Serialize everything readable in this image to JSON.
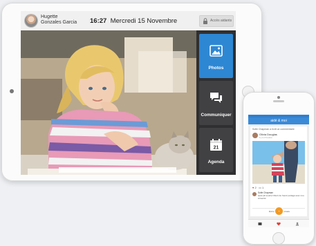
{
  "tablet": {
    "user": {
      "first_name": "Hugette",
      "last_name": "Gonzales Garcia"
    },
    "clock": {
      "time": "16:27",
      "date": "Mercredi 15 Novembre"
    },
    "access_button": {
      "label": "Accès aidants",
      "icon": "lock-icon"
    },
    "sidebar": [
      {
        "label": "Photos",
        "icon": "photo-icon",
        "active": true
      },
      {
        "label": "Communiquer",
        "icon": "chat-bubbles-icon",
        "active": false
      },
      {
        "label": "Agenda",
        "icon": "calendar-icon",
        "day": "21",
        "active": false
      }
    ]
  },
  "phone": {
    "title": "aidé & moi",
    "post": {
      "notice": "Sofie Chapman a écrit un commentaire",
      "author": "Olivia Douglas",
      "time": "il y a 2 heures",
      "likes": "2",
      "comments": "1",
      "comment": {
        "author": "Sofie Chapman",
        "text": "Quel joli sourire! Merci de l'avoir partagé avec moi, à bientôt"
      },
      "reply_label": "Écrire un commentaire"
    },
    "fab_label": "+",
    "tabs": [
      {
        "icon": "home-icon"
      },
      {
        "icon": "heart-icon"
      },
      {
        "icon": "profile-icon"
      }
    ]
  },
  "colors": {
    "accent_blue": "#2e87d3",
    "sidebar_dark": "#2f2f31",
    "fab_orange": "#f19a25"
  }
}
